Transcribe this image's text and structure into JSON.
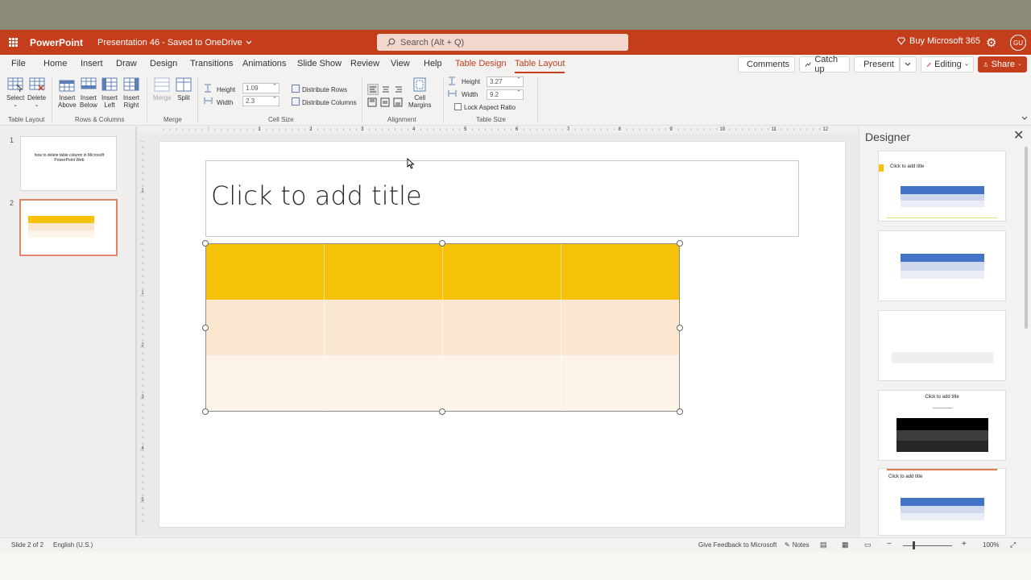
{
  "app": {
    "name": "PowerPoint",
    "document": "Presentation 46  -  Saved to OneDrive",
    "search_placeholder": "Search (Alt + Q)",
    "buy_label": "Buy Microsoft 365",
    "avatar_initials": "GU",
    "brand_color": "#c43e1c"
  },
  "tabs": [
    {
      "label": "File"
    },
    {
      "label": "Home"
    },
    {
      "label": "Insert"
    },
    {
      "label": "Draw"
    },
    {
      "label": "Design"
    },
    {
      "label": "Transitions"
    },
    {
      "label": "Animations"
    },
    {
      "label": "Slide Show"
    },
    {
      "label": "Review"
    },
    {
      "label": "View"
    },
    {
      "label": "Help"
    },
    {
      "label": "Table Design"
    },
    {
      "label": "Table Layout"
    }
  ],
  "right_buttons": {
    "comments": "Comments",
    "catchup": "Catch up",
    "present": "Present",
    "editing": "Editing",
    "share": "Share"
  },
  "ribbon": {
    "table_layout": {
      "label": "Table Layout",
      "select": "Select",
      "delete": "Delete"
    },
    "rows_columns": {
      "label": "Rows & Columns",
      "insert_above": [
        "Insert",
        "Above"
      ],
      "insert_below": [
        "Insert",
        "Below"
      ],
      "insert_left": [
        "Insert",
        "Left"
      ],
      "insert_right": [
        "Insert",
        "Right"
      ]
    },
    "merge": {
      "label": "Merge",
      "merge": "Merge",
      "split": "Split"
    },
    "cell_size": {
      "label": "Cell Size",
      "height_label": "Height",
      "height_value": "1.09",
      "width_label": "Width",
      "width_value": "2.3",
      "distribute_rows": "Distribute Rows",
      "distribute_columns": "Distribute Columns"
    },
    "alignment": {
      "label": "Alignment",
      "cell_margins": [
        "Cell",
        "Margins"
      ]
    },
    "table_size": {
      "label": "Table Size",
      "height_label": "Height",
      "height_value": "3.27",
      "width_label": "Width",
      "width_value": "9.2",
      "lock_aspect": "Lock Aspect Ratio"
    }
  },
  "thumbnails": [
    {
      "num": "1",
      "text": "how to delete table column in Microsoft PowerPoint Web"
    },
    {
      "num": "2",
      "text": ""
    }
  ],
  "slide": {
    "title_placeholder": "Click to add title",
    "table": {
      "rows": 3,
      "cols": 4,
      "row_colors": [
        "#f5c109",
        "#fbe7cf",
        "#fcf3e9"
      ]
    }
  },
  "ruler": {
    "h_labels": [
      "2",
      "1",
      "1",
      "2",
      "3",
      "4",
      "5",
      "6",
      "7",
      "8",
      "9",
      "10",
      "11",
      "12"
    ],
    "v_labels": [
      "1",
      "1",
      "2",
      "3",
      "4",
      "5"
    ]
  },
  "designer": {
    "title": "Designer",
    "cards": [
      {
        "caption": "Click to add title"
      },
      {
        "caption": ""
      },
      {
        "caption": ""
      },
      {
        "caption": "Click to add title"
      },
      {
        "caption": "Click to add title"
      }
    ]
  },
  "status": {
    "slide": "Slide 2 of 2",
    "language": "English (U.S.)",
    "feedback": "Give Feedback to Microsoft",
    "notes": "Notes",
    "zoom": "100%"
  }
}
